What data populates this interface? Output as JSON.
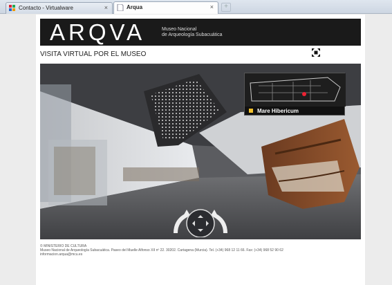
{
  "browser": {
    "tabs": [
      {
        "title": "Contacto - Virtualware",
        "active": false
      },
      {
        "title": "Arqua",
        "active": true
      }
    ],
    "close_glyph": "×",
    "new_tab_glyph": "+"
  },
  "header": {
    "logo": "ARQVA",
    "museum_line1": "Museo Nacional",
    "museum_line2": "de Arqueología Subacuática"
  },
  "page": {
    "subtitle": "VISITA VIRTUAL POR EL MUSEO"
  },
  "minimap": {
    "label": "Mare Hibericum",
    "marker_color": "#f2c12e"
  },
  "footer": {
    "line1": "© MINISTERIO DE CULTURA",
    "line2": "Museo Nacional de Arqueología Subacuática. Paseo del Muelle Alfonso XII nº 22. 30202. Cartagena (Murcia). Tel. (+34) 968 12 11 66. Fax: (+34) 968 52 90 62",
    "line3": "informacion.arqua@mcu.es"
  }
}
